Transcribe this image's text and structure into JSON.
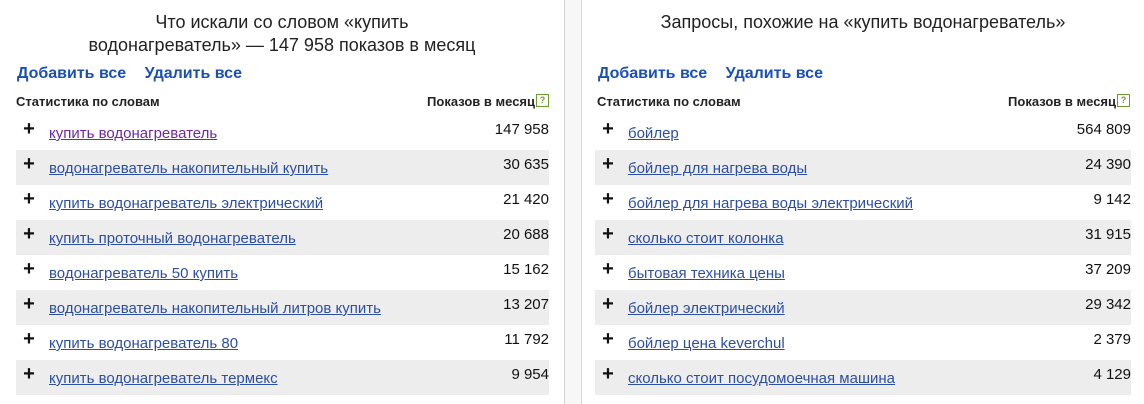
{
  "left": {
    "title_line1": "Что искали со словом «купить",
    "title_line2": "водонагреватель» — 147 958 показов в месяц",
    "add_all": "Добавить все",
    "remove_all": "Удалить все",
    "col_keyword": "Статистика по словам",
    "col_impressions": "Показов в месяц",
    "help_icon": "?",
    "rows": [
      {
        "plus": "+",
        "keyword": "купить водонагреватель",
        "count": "147 958"
      },
      {
        "plus": "+",
        "keyword": "водонагреватель накопительный купить",
        "count": "30 635"
      },
      {
        "plus": "+",
        "keyword": "купить водонагреватель электрический",
        "count": "21 420"
      },
      {
        "plus": "+",
        "keyword": "купить проточный водонагреватель",
        "count": "20 688"
      },
      {
        "plus": "+",
        "keyword": "водонагреватель 50 купить",
        "count": "15 162"
      },
      {
        "plus": "+",
        "keyword": "водонагреватель накопительный литров купить",
        "count": "13 207"
      },
      {
        "plus": "+",
        "keyword": "купить водонагреватель 80",
        "count": "11 792"
      },
      {
        "plus": "+",
        "keyword": "купить водонагреватель термекс",
        "count": "9 954"
      }
    ]
  },
  "right": {
    "title": "Запросы, похожие на «купить водонагреватель»",
    "add_all": "Добавить все",
    "remove_all": "Удалить все",
    "col_keyword": "Статистика по словам",
    "col_impressions": "Показов в месяц",
    "help_icon": "?",
    "rows": [
      {
        "plus": "+",
        "keyword": "бойлер",
        "count": "564 809"
      },
      {
        "plus": "+",
        "keyword": "бойлер для нагрева воды",
        "count": "24 390"
      },
      {
        "plus": "+",
        "keyword": "бойлер для нагрева воды электрический",
        "count": "9 142"
      },
      {
        "plus": "+",
        "keyword": "сколько стоит колонка",
        "count": "31 915"
      },
      {
        "plus": "+",
        "keyword": "бытовая техника цены",
        "count": "37 209"
      },
      {
        "plus": "+",
        "keyword": "бойлер электрический",
        "count": "29 342"
      },
      {
        "plus": "+",
        "keyword": "бойлер цена keverchul",
        "count": "2 379"
      },
      {
        "plus": "+",
        "keyword": "сколько стоит посудомоечная машина",
        "count": "4 129"
      }
    ]
  },
  "colors": {
    "link": "#2d4fa0",
    "visited": "#6c2a9e",
    "action": "#1a4fb5",
    "row_alt": "#ededed"
  }
}
